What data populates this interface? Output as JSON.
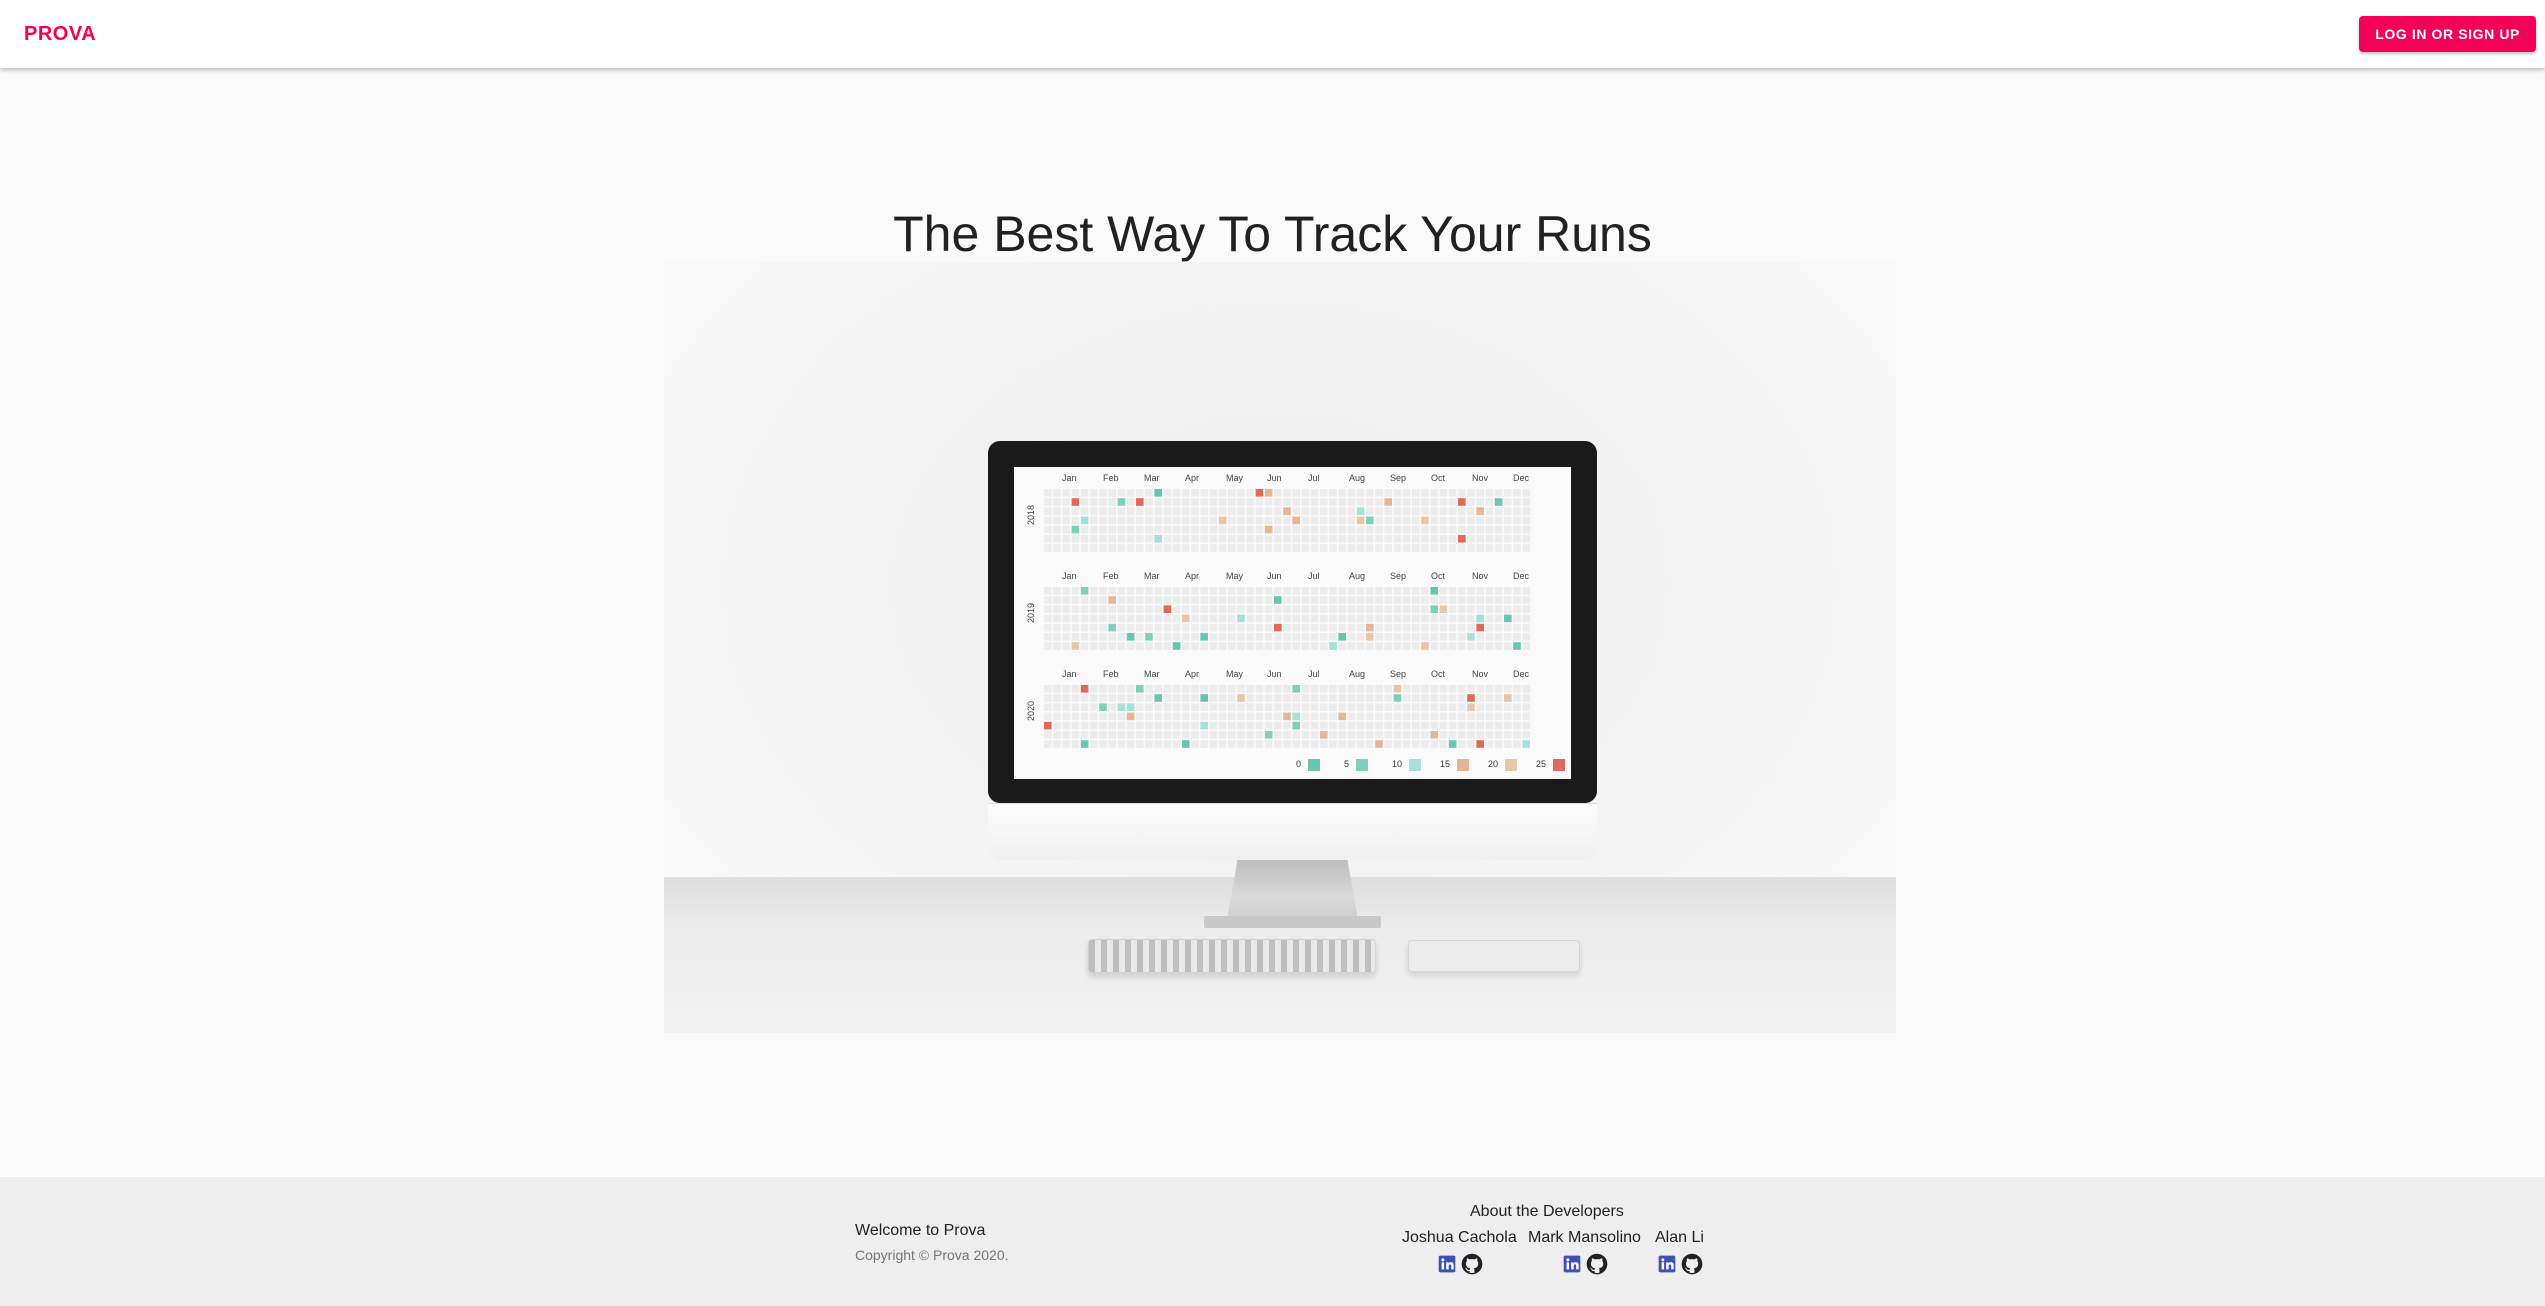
{
  "header": {
    "brand": "PROVA",
    "login_label": "LOG IN OR SIGN UP"
  },
  "hero": {
    "title": "The Best Way To Track Your Runs"
  },
  "calendar_screen": {
    "years": [
      "2018",
      "2019",
      "2020"
    ],
    "months": [
      "Jan",
      "Feb",
      "Mar",
      "Apr",
      "May",
      "Jun",
      "Jul",
      "Aug",
      "Sep",
      "Oct",
      "Nov",
      "Dec"
    ],
    "legend": [
      "0",
      "5",
      "10",
      "15",
      "20",
      "25"
    ],
    "legend_colors": [
      "#69c4b0",
      "#7ed0bd",
      "#a7e0d8",
      "#e8b594",
      "#e8c7a8",
      "#e0695a"
    ]
  },
  "footer": {
    "welcome": "Welcome to Prova",
    "copyright": "Copyright © Prova 2020.",
    "developers_heading": "About the Developers",
    "developers": [
      {
        "name": "Joshua Cachola"
      },
      {
        "name": "Mark Mansolino"
      },
      {
        "name": "Alan Li"
      }
    ]
  },
  "colors": {
    "accent": "#f50057",
    "linkedin": "#3f51b5",
    "github": "#212121"
  }
}
